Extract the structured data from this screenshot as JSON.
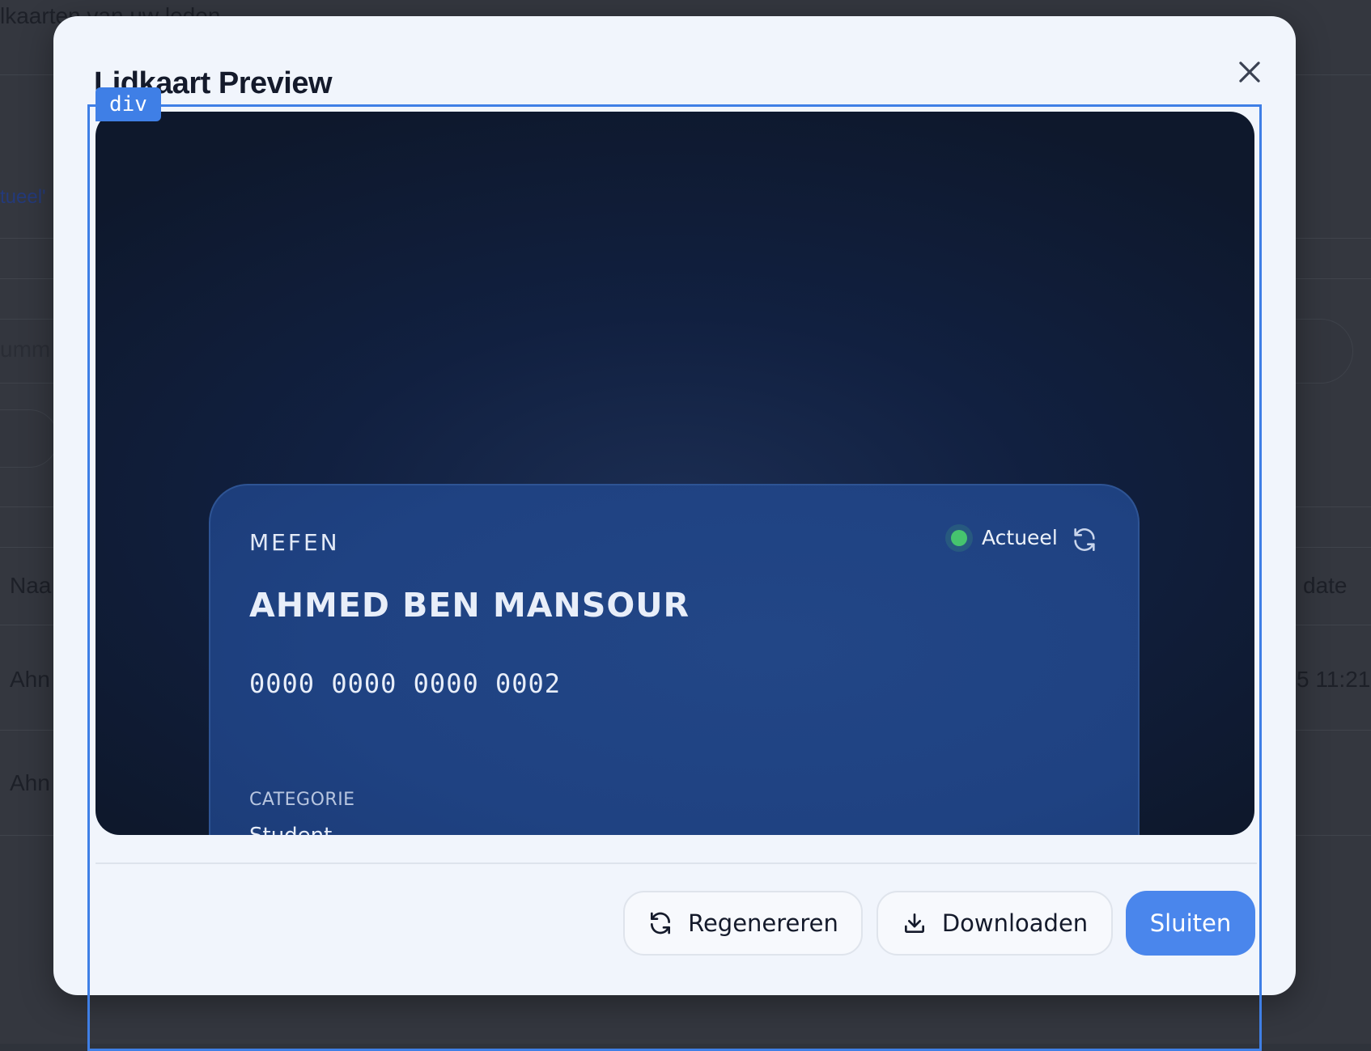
{
  "background": {
    "heading_fragment": "lkaarten van uw leden",
    "link_fragment": "tueel'",
    "search_fragment": "umm",
    "column_name_fragment": "Naa",
    "column_update_fragment": "date",
    "row1_name_fragment": "Ahn",
    "row1_time_fragment": "5 11:21",
    "row2_name_fragment": "Ahn"
  },
  "modal": {
    "title": "Lidkaart Preview",
    "dev_label": "div"
  },
  "card": {
    "organization": "MEFEN",
    "status_label": "Actueel",
    "member_name": "AHMED BEN MANSOUR",
    "card_number": "0000 0000 0000 0002",
    "category_label": "CATEGORIE",
    "category_value": "Student"
  },
  "footer": {
    "regenerate_label": "Regenereren",
    "download_label": "Downloaden",
    "close_label": "Sluiten"
  },
  "colors": {
    "accent": "#4a86ec",
    "status_ok": "#46c46e",
    "card_bg": "#1f4282",
    "stage_bg": "#0e182c"
  },
  "icons": [
    "close-icon",
    "refresh-icon",
    "regenerate-icon",
    "download-icon"
  ]
}
